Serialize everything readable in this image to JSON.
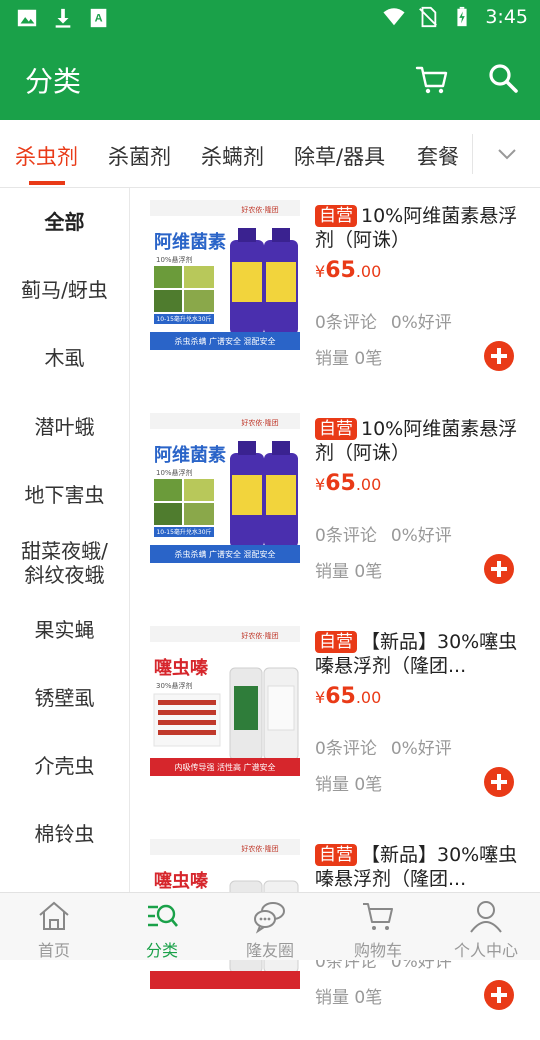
{
  "status_bar": {
    "time": "3:45"
  },
  "app_bar": {
    "title": "分类"
  },
  "tabs": [
    "杀虫剂",
    "杀菌剂",
    "杀螨剂",
    "除草/器具",
    "套餐"
  ],
  "sidebar": [
    "全部",
    "蓟马/蚜虫",
    "木虱",
    "潜叶蛾",
    "地下害虫",
    "甜菜夜蛾/\n斜纹夜蛾",
    "果实蝇",
    "锈壁虱",
    "介壳虫",
    "棉铃虫"
  ],
  "products": [
    {
      "tag": "自营",
      "title": "10%阿维菌素悬浮剂（阿诛）",
      "currency": "¥",
      "price_main": "65",
      "price_cents": ".00",
      "reviews": "0条评论",
      "rating": "0%好评",
      "sales": "销量 0笔",
      "image": {
        "brand": "好农依·隆团",
        "name": "阿维菌素",
        "spec": "10%悬浮剂",
        "dose": "10-15毫升兑水30斤",
        "footer": "杀虫杀螨 广谱安全 混配安全"
      }
    },
    {
      "tag": "自营",
      "title": "10%阿维菌素悬浮剂（阿诛）",
      "currency": "¥",
      "price_main": "65",
      "price_cents": ".00",
      "reviews": "0条评论",
      "rating": "0%好评",
      "sales": "销量 0笔",
      "image": {
        "brand": "好农依·隆团",
        "name": "阿维菌素",
        "spec": "10%悬浮剂",
        "dose": "10-15毫升兑水30斤",
        "footer": "杀虫杀螨 广谱安全 混配安全"
      }
    },
    {
      "tag": "自营",
      "title": "【新品】30%噻虫嗪悬浮剂（隆团...",
      "currency": "¥",
      "price_main": "65",
      "price_cents": ".00",
      "reviews": "0条评论",
      "rating": "0%好评",
      "sales": "销量 0笔",
      "image": {
        "brand": "好农依·隆团",
        "name": "噻虫嗪",
        "spec": "30%悬浮剂",
        "dose": "",
        "footer": "内吸传导强 活性高 广谱安全"
      }
    },
    {
      "tag": "自营",
      "title": "【新品】30%噻虫嗪悬浮剂（隆团...",
      "currency": "¥",
      "price_main": "65",
      "price_cents": ".00",
      "reviews": "0条评论",
      "rating": "0%好评",
      "sales": "销量 0笔",
      "image": {
        "brand": "好农依·隆团",
        "name": "噻虫嗪",
        "spec": "30%悬浮剂",
        "dose": "",
        "footer": ""
      }
    }
  ],
  "bottom_nav": [
    {
      "label": "首页",
      "icon": "home-icon"
    },
    {
      "label": "分类",
      "icon": "category-icon"
    },
    {
      "label": "隆友圈",
      "icon": "chat-icon"
    },
    {
      "label": "购物车",
      "icon": "cart-icon"
    },
    {
      "label": "个人中心",
      "icon": "user-icon"
    }
  ],
  "colors": {
    "primary": "#1aa149",
    "accent": "#e93a17"
  }
}
